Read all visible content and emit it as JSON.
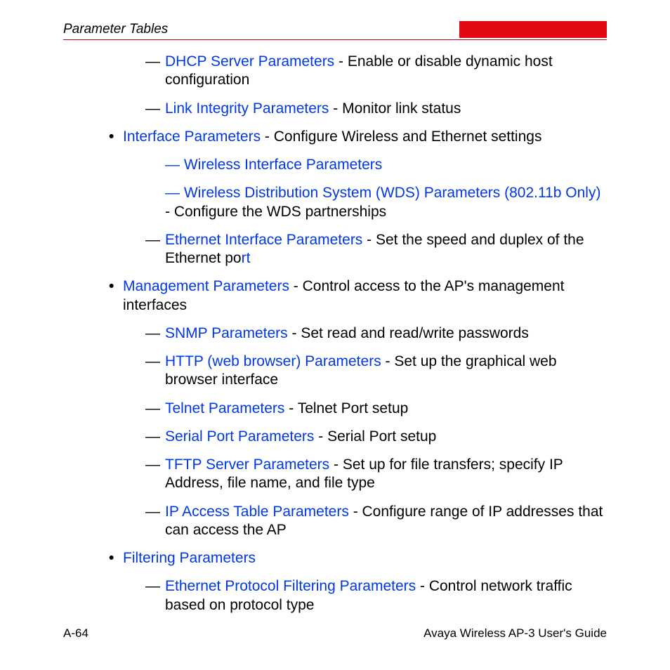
{
  "header": {
    "title": "Parameter Tables"
  },
  "items": {
    "dhcp": {
      "link": "DHCP Server Parameters",
      "desc": " - Enable or disable dynamic host configuration"
    },
    "link_integrity": {
      "link": "Link Integrity Parameters",
      "desc": " - Monitor link status"
    },
    "interface": {
      "link": "Interface Parameters",
      "desc": " - Configure Wireless and Ethernet settings"
    },
    "wireless_if": {
      "dash": "— ",
      "link": "Wireless Interface Parameters"
    },
    "wds": {
      "dash": "— ",
      "link": "Wireless Distribution System (WDS) Parameters (802.11b Only)",
      "desc": " - Configure the WDS partnerships"
    },
    "eth_if": {
      "link": "Ethernet Interface Parameters",
      "desc1": " - Set the speed and duplex of the Ethernet po",
      "rt": "rt"
    },
    "management": {
      "link": "Management Parameters",
      "desc": " - Control access to the AP's management interfaces"
    },
    "snmp": {
      "link": "SNMP Parameters",
      "desc": " - Set read and read/write passwords"
    },
    "http": {
      "link": "HTTP (web browser) Parameters",
      "desc": " - Set up the graphical web browser interface"
    },
    "telnet": {
      "link": "Telnet Parameters",
      "desc": " - Telnet Port setup"
    },
    "serial": {
      "link": "Serial Port Parameters",
      "desc": " - Serial Port setup"
    },
    "tftp": {
      "link": "TFTP Server Parameters",
      "desc": " - Set up for file transfers; specify IP Address, file name, and file type"
    },
    "ipaccess": {
      "link": "IP Access Table Parameters",
      "desc": " - Configure range of IP addresses that can access the AP"
    },
    "filtering": {
      "link": "Filtering Parameters"
    },
    "eth_proto": {
      "link": "Ethernet Protocol Filtering Parameters",
      "desc": " - Control network traffic based on protocol type"
    }
  },
  "dashes": {
    "plain": "— "
  },
  "bullet": "•",
  "footer": {
    "left": "A-64",
    "right": "Avaya Wireless AP-3 User's Guide"
  }
}
